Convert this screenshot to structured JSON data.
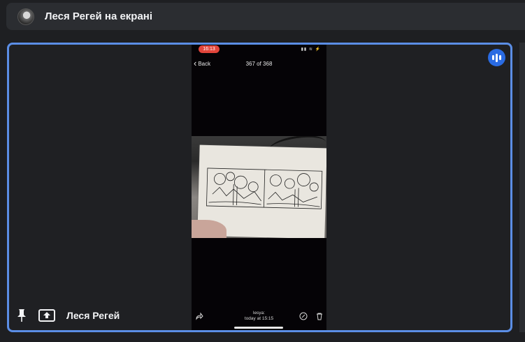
{
  "header": {
    "title": "Леся Регей на екрані"
  },
  "phone": {
    "status_time": "16:13",
    "back_label": "Back",
    "counter": "367 of 368",
    "author": "lesya:",
    "timestamp": "today at 15:15"
  },
  "footer": {
    "user_name": "Леся Регей"
  },
  "colors": {
    "accent_border": "#5b8ee6",
    "voice_button": "#2a6be2",
    "status_pill": "#e2453b"
  }
}
